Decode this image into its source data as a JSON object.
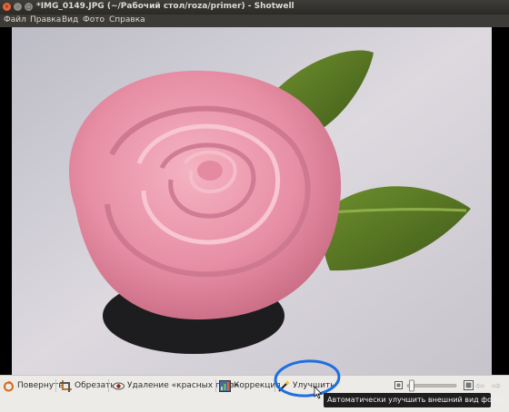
{
  "window": {
    "title": "*IMG_0149.JPG (~/Рабочий стол/roza/primer) - Shotwell",
    "close_glyph": "×",
    "minimize_glyph": "–",
    "maximize_glyph": "□"
  },
  "menu": {
    "items": [
      "Файл",
      "Правка",
      "Вид",
      "Фото",
      "Справка"
    ]
  },
  "toolbar": {
    "rotate_label": "Повернуть",
    "crop_label": "Обрезать",
    "redeye_label": "Удаление «красных глаз»",
    "adjust_label": "Коррекция",
    "enhance_label": "Улучшить",
    "zoom_level": 0.05
  },
  "tooltip": {
    "text": "Автоматически улучшить внешний вид фото"
  },
  "colors": {
    "title_bg": "#3c3b37",
    "close_button": "#e9653a",
    "toolbar_bg": "#edebe8",
    "annotation_circle": "#1f6fe0"
  }
}
